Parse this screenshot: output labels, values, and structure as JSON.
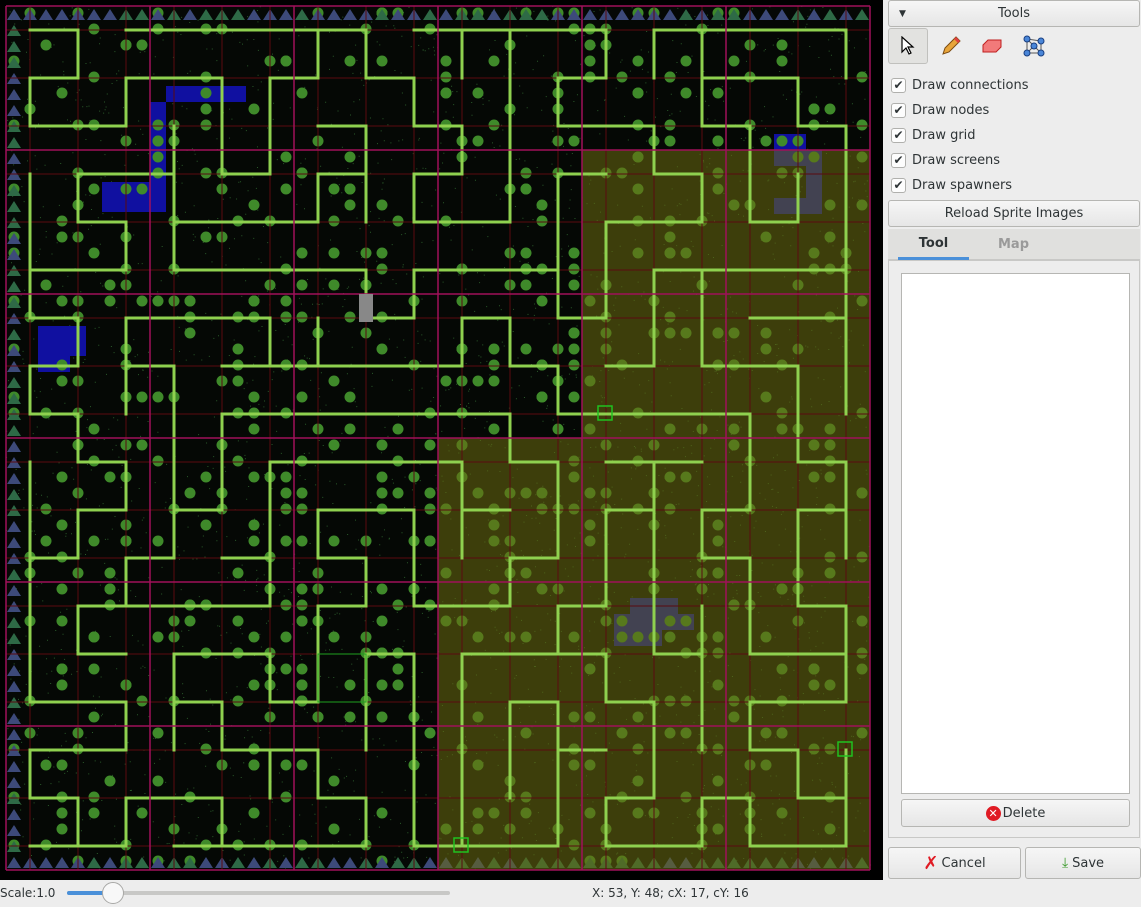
{
  "map": {
    "colors": {
      "background": "#000000",
      "connection": "#8fd14f",
      "screen_grid": "#a0105a",
      "node_grid": "#5a0a10",
      "highlight": "#6b6b10",
      "water": "#1010a0"
    }
  },
  "tools": {
    "header_label": "Tools",
    "icons": [
      "pointer-icon",
      "pencil-icon",
      "eraser-icon",
      "nodes-icon"
    ],
    "checkboxes": [
      {
        "label": "Draw connections",
        "checked": true
      },
      {
        "label": "Draw nodes",
        "checked": true
      },
      {
        "label": "Draw grid",
        "checked": true
      },
      {
        "label": "Draw screens",
        "checked": true
      },
      {
        "label": "Draw spawners",
        "checked": true
      }
    ],
    "reload_label": "Reload Sprite Images",
    "tabs": [
      {
        "label": "Tool",
        "active": true
      },
      {
        "label": "Map",
        "active": false
      }
    ],
    "delete_label": "Delete",
    "cancel_label": "Cancel",
    "save_label": "Save"
  },
  "status": {
    "scale_label": "Scale:1.0",
    "scale_value": 1.0,
    "coords": "X: 53, Y: 48; cX: 17, cY: 16"
  }
}
